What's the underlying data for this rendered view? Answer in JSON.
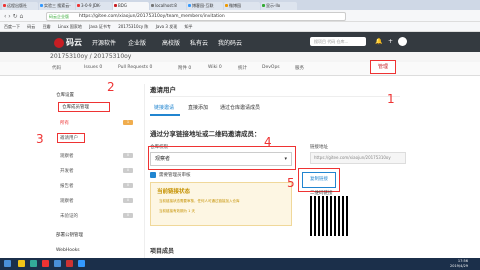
{
  "browser": {
    "tabs": [
      "远程出版社",
      "实验三 搜索云-",
      "3-0-9 JDK-",
      "BDG",
      "localhost:8",
      "博客园-互联",
      "微博园",
      "显示-Ilo"
    ],
    "url": "https://gitee.com/xiaojun/20175310oy/team_members/invitation",
    "url_prefix": "码云企业版",
    "bookmarks": [
      "百度一下",
      "码云",
      "豆瓣",
      "Linux 国家地",
      "Java 证书专",
      "20175310cy 陈",
      "Java 3 发现",
      "知乎"
    ]
  },
  "site": {
    "logo": "码云",
    "nav": [
      "开源软件",
      "企业版",
      "高校版",
      "私有云",
      "我的码云"
    ],
    "search_placeholder": "搜项目 代码 仓库...",
    "project_title": "20175310oy / 20175310oy"
  },
  "subnav": [
    "代码",
    "Issues 0",
    "Pull Requests 0",
    "附件 0",
    "Wiki 0",
    "统计",
    "DevOps",
    "服务",
    "管理"
  ],
  "sidebar": {
    "settings_label": "仓库设置",
    "members_label": "仓库成员管理",
    "items": [
      {
        "label": "所有",
        "badge": "1"
      },
      {
        "label": "邀请用户",
        "badge": ""
      },
      {
        "label": "观察者",
        "badge": "0"
      },
      {
        "label": "开发者",
        "badge": "0"
      },
      {
        "label": "报告者",
        "badge": "0"
      },
      {
        "label": "观察者",
        "badge": "0"
      },
      {
        "label": "未验证的",
        "badge": "0"
      }
    ],
    "deploy": "部署公钥管理",
    "webhooks": "WebHooks"
  },
  "main": {
    "title": "邀请用户",
    "tabs": [
      "链接邀请",
      "直接添加",
      "通过仓库邀请成员"
    ],
    "section": "通过分享链接地址或二维码邀请成员：",
    "perm_label": "仓库权限",
    "perm_value": "观察者",
    "checkbox_label": "需要管理员审核",
    "info_title": "当前链接状态",
    "info_lines": [
      "当前链接状态需要审核，任何人可通过链接加入仓库",
      "当前链接有效期为 1 天"
    ],
    "link_label": "链接地址",
    "link_value": "https://gitee.com/xiaojun/20175310oy",
    "copy_btn": "复制链接",
    "qr_label": "二维码链接",
    "bottom_heading": "项目成员"
  },
  "annotations": [
    "1",
    "2",
    "3",
    "4",
    "5"
  ],
  "taskbar": {
    "time": "17:56",
    "date": "2019/4/29"
  }
}
